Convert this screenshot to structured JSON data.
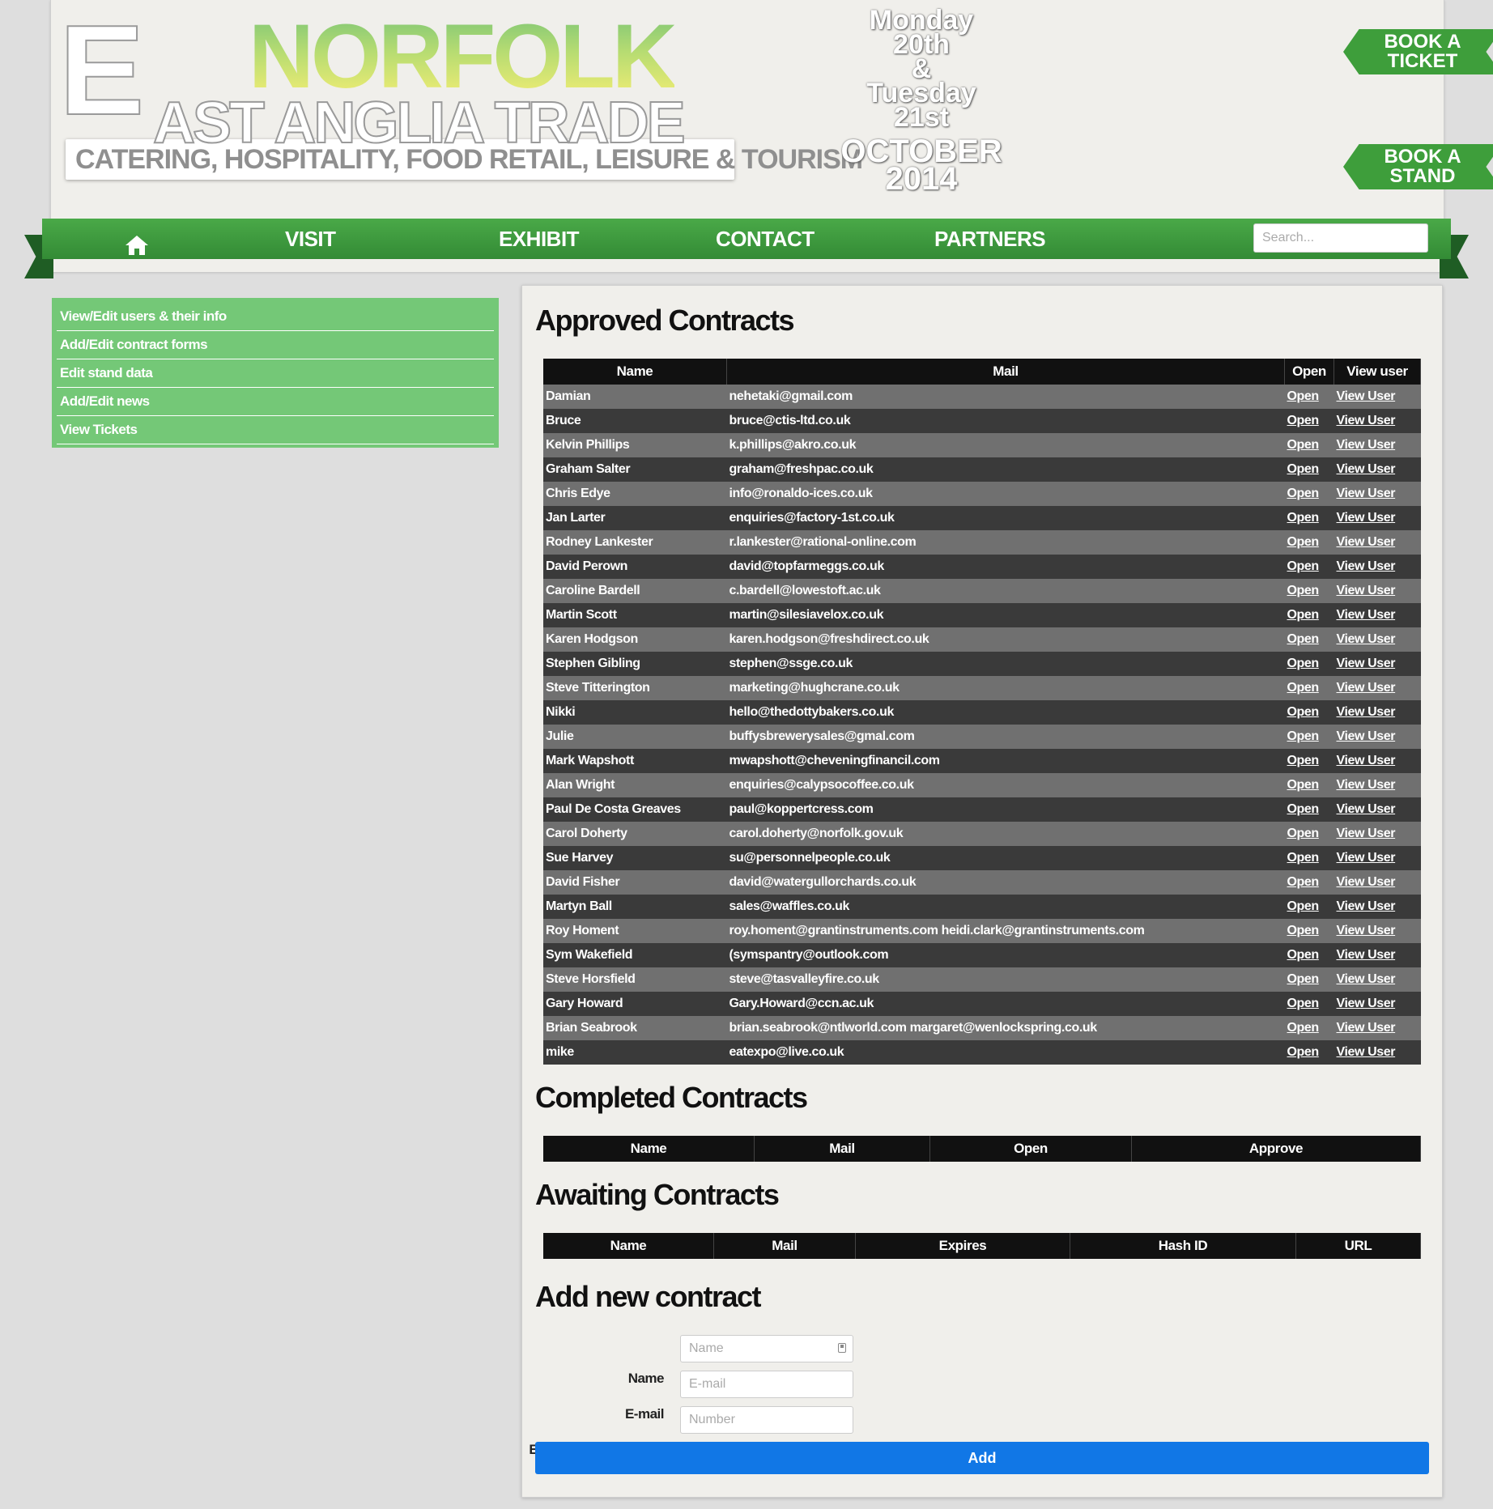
{
  "header": {
    "logo": {
      "letter": "E",
      "region": "NORFOLK",
      "rest": "AST ANGLIA TRADE",
      "tagline": "CATERING, HOSPITALITY, FOOD RETAIL, LEISURE & TOURISM"
    },
    "dates": {
      "day1": "Monday 20th",
      "amp": "&",
      "day2": "Tuesday 21st",
      "month": "OCTOBER",
      "year": "2014"
    },
    "book_ticket": "BOOK A TICKET",
    "book_stand": "BOOK A STAND"
  },
  "nav": {
    "visit": "VISIT",
    "exhibit": "EXHIBIT",
    "contact": "CONTACT",
    "partners": "PARTNERS",
    "search_placeholder": "Search..."
  },
  "sidebar": {
    "items": [
      {
        "label": "View/Edit users & their info"
      },
      {
        "label": "Add/Edit contract forms"
      },
      {
        "label": "Edit stand data"
      },
      {
        "label": "Add/Edit news"
      },
      {
        "label": "View Tickets"
      }
    ]
  },
  "approved": {
    "title": "Approved Contracts",
    "columns": [
      "Name",
      "Mail",
      "Open",
      "View user"
    ],
    "rows": [
      {
        "name": "Damian",
        "mail": "nehetaki@gmail.com",
        "open": "Open",
        "view": "View User"
      },
      {
        "name": "Bruce",
        "mail": "bruce@ctis-ltd.co.uk",
        "open": "Open",
        "view": "View User"
      },
      {
        "name": "Kelvin Phillips",
        "mail": "k.phillips@akro.co.uk",
        "open": "Open",
        "view": "View User"
      },
      {
        "name": "Graham Salter",
        "mail": "graham@freshpac.co.uk",
        "open": "Open",
        "view": "View User"
      },
      {
        "name": "Chris Edye",
        "mail": "info@ronaldo-ices.co.uk",
        "open": "Open",
        "view": "View User"
      },
      {
        "name": "Jan Larter",
        "mail": "enquiries@factory-1st.co.uk",
        "open": "Open",
        "view": "View User"
      },
      {
        "name": "Rodney Lankester",
        "mail": "r.lankester@rational-online.com",
        "open": "Open",
        "view": "View User"
      },
      {
        "name": "David Perown",
        "mail": "david@topfarmeggs.co.uk",
        "open": "Open",
        "view": "View User"
      },
      {
        "name": "Caroline Bardell",
        "mail": "c.bardell@lowestoft.ac.uk",
        "open": "Open",
        "view": "View User"
      },
      {
        "name": "Martin Scott",
        "mail": "martin@silesiavelox.co.uk",
        "open": "Open",
        "view": "View User"
      },
      {
        "name": "Karen Hodgson",
        "mail": "karen.hodgson@freshdirect.co.uk",
        "open": "Open",
        "view": "View User"
      },
      {
        "name": "Stephen Gibling",
        "mail": "stephen@ssge.co.uk",
        "open": "Open",
        "view": "View User"
      },
      {
        "name": "Steve Titterington",
        "mail": "marketing@hughcrane.co.uk",
        "open": "Open",
        "view": "View User"
      },
      {
        "name": "Nikki",
        "mail": "hello@thedottybakers.co.uk",
        "open": "Open",
        "view": "View User"
      },
      {
        "name": "Julie",
        "mail": "buffysbrewerysales@gmal.com",
        "open": "Open",
        "view": "View User"
      },
      {
        "name": "Mark Wapshott",
        "mail": "mwapshott@cheveningfinancil.com",
        "open": "Open",
        "view": "View User"
      },
      {
        "name": "Alan Wright",
        "mail": "enquiries@calypsocoffee.co.uk",
        "open": "Open",
        "view": "View User"
      },
      {
        "name": "Paul De Costa Greaves",
        "mail": "paul@koppertcress.com",
        "open": "Open",
        "view": "View User"
      },
      {
        "name": "Carol Doherty",
        "mail": "carol.doherty@norfolk.gov.uk",
        "open": "Open",
        "view": "View User"
      },
      {
        "name": "Sue Harvey",
        "mail": "su@personnelpeople.co.uk",
        "open": "Open",
        "view": "View User"
      },
      {
        "name": "David Fisher",
        "mail": "david@watergullorchards.co.uk",
        "open": "Open",
        "view": "View User"
      },
      {
        "name": "Martyn Ball",
        "mail": "sales@waffles.co.uk",
        "open": "Open",
        "view": "View User"
      },
      {
        "name": "Roy Homent",
        "mail": "roy.homent@grantinstruments.com heidi.clark@grantinstruments.com",
        "open": "Open",
        "view": "View User"
      },
      {
        "name": "Sym Wakefield",
        "mail": "(symspantry@outlook.com",
        "open": "Open",
        "view": "View User"
      },
      {
        "name": "Steve Horsfield",
        "mail": "steve@tasvalleyfire.co.uk",
        "open": "Open",
        "view": "View User"
      },
      {
        "name": "Gary Howard",
        "mail": "Gary.Howard@ccn.ac.uk",
        "open": "Open",
        "view": "View User"
      },
      {
        "name": "Brian Seabrook",
        "mail": "brian.seabrook@ntlworld.com margaret@wenlockspring.co.uk",
        "open": "Open",
        "view": "View User"
      },
      {
        "name": "mike",
        "mail": "eatexpo@live.co.uk",
        "open": "Open",
        "view": "View User"
      }
    ]
  },
  "completed": {
    "title": "Completed Contracts",
    "columns": [
      "Name",
      "Mail",
      "Open",
      "Approve"
    ]
  },
  "awaiting": {
    "title": "Awaiting Contracts",
    "columns": [
      "Name",
      "Mail",
      "Expires",
      "Hash ID",
      "URL"
    ]
  },
  "new_contract": {
    "title": "Add new contract",
    "name_label": "Name",
    "name_placeholder": "Name",
    "email_label": "E-mail",
    "email_placeholder": "E-mail",
    "expiry_label": "Expiration time (days)",
    "expiry_placeholder": "Number",
    "add_label": "Add"
  }
}
